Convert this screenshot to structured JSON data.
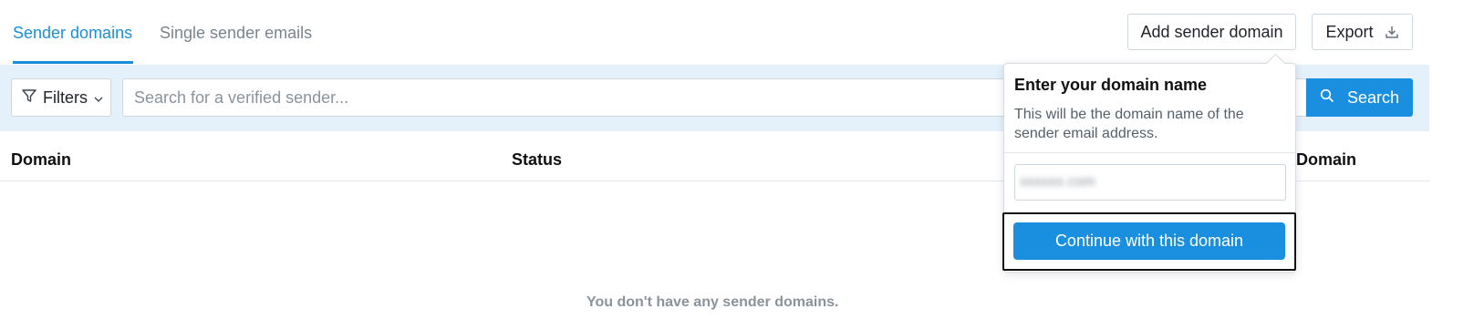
{
  "tabs": {
    "active": "Sender domains",
    "inactive": "Single sender emails"
  },
  "toolbar": {
    "add_label": "Add sender domain",
    "export_label": "Export"
  },
  "filters": {
    "filters_label": "Filters",
    "search_placeholder": "Search for a verified sender...",
    "search_label": "Search"
  },
  "table": {
    "columns": [
      "Domain",
      "Status",
      "Domain"
    ],
    "empty_message": "You don't have any sender domains."
  },
  "popover": {
    "title": "Enter your domain name",
    "description": "This will be the domain name of the sender email address.",
    "input_value": "xxxxxx.com",
    "continue_label": "Continue with this domain"
  },
  "colors": {
    "accent": "#1a8fe0",
    "filter_bar_bg": "#e4f1fb"
  }
}
